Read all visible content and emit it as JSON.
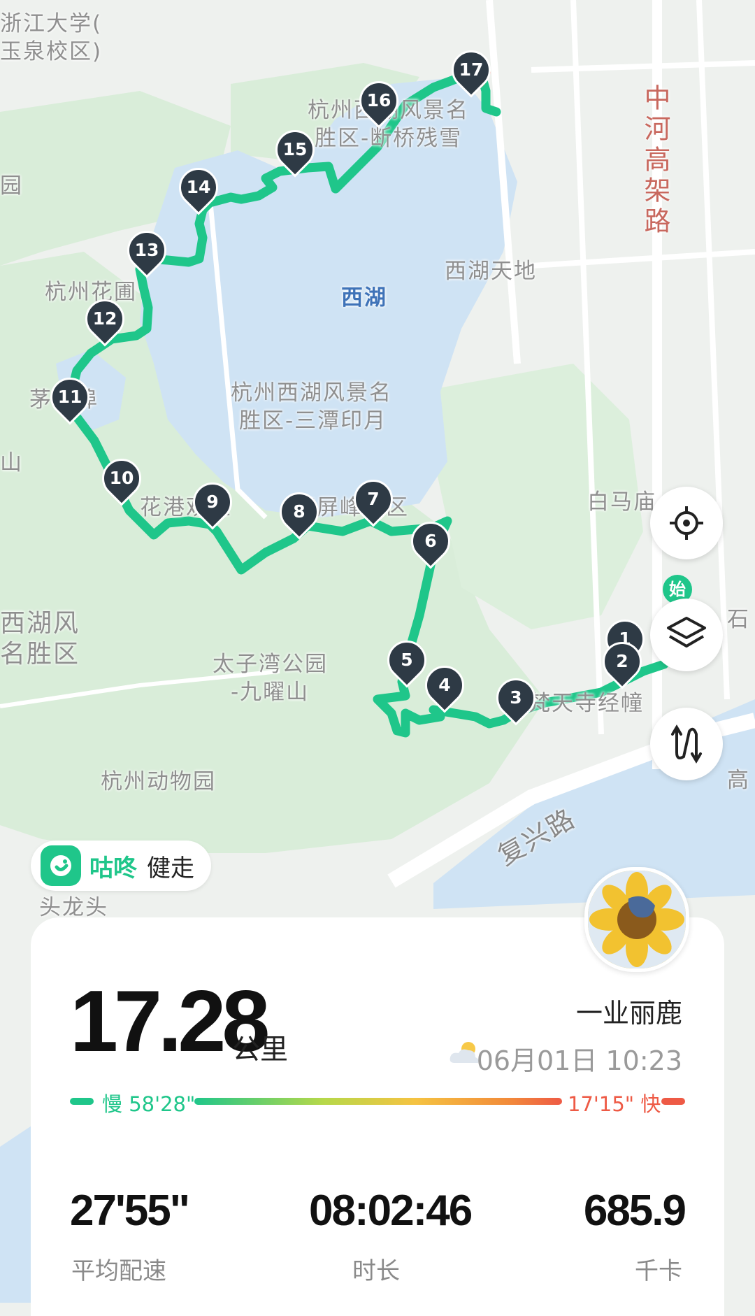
{
  "map": {
    "labels": {
      "zju_line1": "浙江大学(",
      "zju_line2": "玉泉校区)",
      "park_left": "园",
      "scenic_north_1": "杭州西湖风景名",
      "scenic_north_2": "胜区-断桥残雪",
      "zhonghe_road": "中河高架路",
      "xihu_tiandi": "西湖天地",
      "flower_garden": "杭州花圃",
      "west_lake": "西湖",
      "maojiabu": "茅家埠",
      "shan": "山",
      "santan_1": "杭州西湖风景名",
      "santan_2": "胜区-三潭印月",
      "huagang": "花港观鱼",
      "nanping": "南屏峰景区",
      "baima": "白马庙",
      "scenic_west_1": "西湖风",
      "scenic_west_2": "名胜区",
      "taiziwan_1": "太子湾公园",
      "taiziwan_2": "-九曜山",
      "fantian": "梵天寺经幢",
      "shi": "石",
      "zoo": "杭州动物园",
      "fuxing_road": "复兴路",
      "gao": "高",
      "toulongtou": "头龙头"
    },
    "markers": [
      "1",
      "2",
      "3",
      "4",
      "5",
      "6",
      "7",
      "8",
      "9",
      "10",
      "11",
      "12",
      "13",
      "14",
      "15",
      "16",
      "17"
    ],
    "start_label": "始",
    "route_color": "#1fc68a",
    "lake_color": "#cfe3f4",
    "green_color": "#d9edd9"
  },
  "controls": {
    "locate_icon": "locate-icon",
    "layers_icon": "layers-icon",
    "route_icon": "route-switch-icon"
  },
  "brand": {
    "name": "咕咚",
    "mode": "健走"
  },
  "summary": {
    "distance": "17.28",
    "distance_unit": "公里",
    "username": "一业丽鹿",
    "date": "06月01日 10:23",
    "pace_slow": "慢 58'28\"",
    "pace_fast": "17'15\" 快",
    "avg_pace": "27'55\"",
    "avg_pace_label": "平均配速",
    "duration": "08:02:46",
    "duration_label": "时长",
    "calories": "685.9",
    "calories_label": "千卡"
  }
}
